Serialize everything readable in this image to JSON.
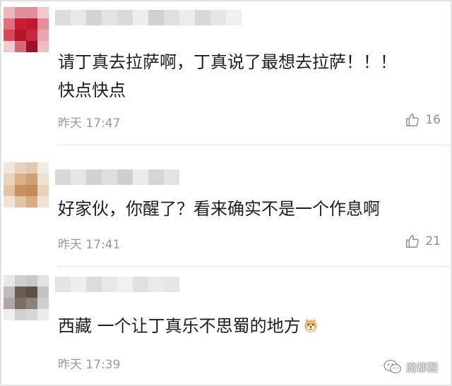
{
  "comments": [
    {
      "text_lines": [
        "请丁真去拉萨啊，丁真说了最想去拉萨！！！",
        "快点快点"
      ],
      "time": "昨天 17:47",
      "likes": "16",
      "avatar_colors": [
        "#e9b8bf",
        "#e28f9b",
        "#e28f9b",
        "#f0c9cf",
        "#e0707f",
        "#c81e35",
        "#c11a30",
        "#e48e9a",
        "#d4485c",
        "#b5142b",
        "#c8283f",
        "#e8a6b0",
        "#f0ccd1",
        "#d86878",
        "#a01025",
        "#edbcc4"
      ],
      "username_colors": [
        "#dcdcdc",
        "#e8e8e8",
        "#d4d4d4",
        "#e4e4e4",
        "#dadada",
        "#eeeeee",
        "#d0d0d0",
        "#e0e0e0",
        "#ececec",
        "#d8d8d8",
        "#e6e6e6",
        "#f0f0f0"
      ]
    },
    {
      "text_lines": [
        "好家伙，你醒了？看来确实不是一个作息啊"
      ],
      "time": "昨天 17:41",
      "likes": "21",
      "avatar_colors": [
        "#f2e6dc",
        "#e7d2bf",
        "#e3c9b0",
        "#f3ebe3",
        "#ead3bb",
        "#d9b08a",
        "#cda07a",
        "#efe2d4",
        "#e4c3a2",
        "#c98f5e",
        "#c48a5a",
        "#e8d1b9",
        "#f1e4d6",
        "#e2c4a4",
        "#d5ae88",
        "#f0e3d5"
      ],
      "username_colors": [
        "#d8d8d8",
        "#e6e6e6",
        "#d2d2d2",
        "#dedede",
        "#cfcfcf",
        "#ebebeb",
        "#d5d5d5",
        "#e3e3e3"
      ]
    },
    {
      "text_lines": [
        "西藏 一个让丁真乐不思蜀的地方"
      ],
      "time": "昨天 17:39",
      "likes": "",
      "avatar_colors": [
        "#e8e8e8",
        "#cfcfcf",
        "#c8c8c8",
        "#e2e2e2",
        "#bdbdbd",
        "#6a5a52",
        "#5e4f48",
        "#c2c2c2",
        "#b0a7a2",
        "#7a6e67",
        "#8b807a",
        "#cfcfcf",
        "#eeeeee",
        "#d0d0d0",
        "#d6d6d6",
        "#ececec"
      ],
      "username_colors": [
        "#e4e4e4",
        "#eeeeee",
        "#dcdcdc",
        "#e8e8e8",
        "#f0f0f0",
        "#e0e0e0",
        "#eaeaea",
        "#e6e6e6"
      ]
    }
  ],
  "watermark": {
    "label": "魔都图"
  },
  "icons": {
    "like": "thumbs-up-icon",
    "emoji": "doge-emoji-icon",
    "watermark": "wechat-icon"
  }
}
